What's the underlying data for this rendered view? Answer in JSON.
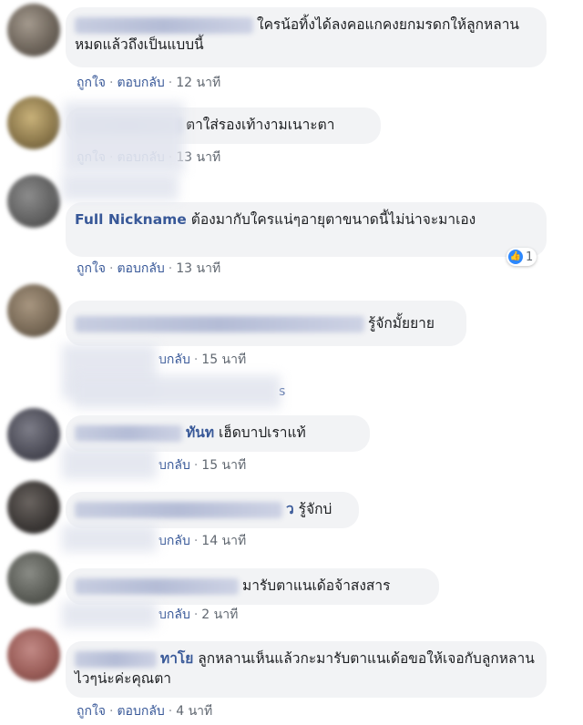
{
  "labels": {
    "like": "ถูกใจ",
    "reply": "ตอบกลับ",
    "separator": "·"
  },
  "comments": [
    {
      "text": "ใครน้อทิ้งได้ลงคอแกคงยกมรดกให้ลูกหลานหมดแล้วถึงเป็นแบบนี้",
      "time": "12 นาที"
    },
    {
      "text": "ตาใส่รองเท้างามเนาะตา",
      "time": "13 นาที"
    },
    {
      "name": "Full Nickname",
      "text": "ต้องมากับใครแน่ๆอายุตาขนาดนี้ไม่น่าจะมาเอง",
      "time": "13 นาที",
      "reaction_count": "1"
    },
    {
      "text": "รู้จักมั้ยยาย",
      "reply_partial": "บกลับ",
      "time": "15 นาที",
      "replies_partial": "s"
    },
    {
      "name_partial": "ทันท",
      "text": "เฮ็ดบาปเราแท้",
      "reply_partial": "บกลับ",
      "time": "15 นาที"
    },
    {
      "name_partial": "ว",
      "text": "รู้จักบ่",
      "reply_partial": "บกลับ",
      "time": "14 นาที"
    },
    {
      "text": "มารับตาแนเด้อจ้าสงสาร",
      "reply_partial": "บกลับ",
      "time": "2 นาที"
    },
    {
      "name_partial": "ทาโย",
      "text": "ลูกหลานเห็นแล้วกะมารับตาแนเด้อขอให้เจอกับลูกหลานไวๆน่ะค่ะคุณตา",
      "time": "4 นาที"
    }
  ]
}
